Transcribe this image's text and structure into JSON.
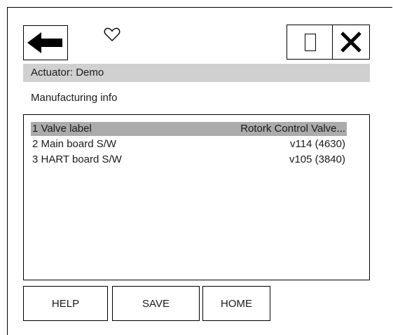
{
  "header": {
    "back_icon": "arrow-left-icon",
    "favorite_icon": "heart-outline-icon",
    "stop_icon": "square-icon",
    "close_icon": "close-x-icon",
    "title": "Actuator: Demo"
  },
  "page": {
    "subtitle": "Manufacturing info"
  },
  "list": {
    "items": [
      {
        "label": "1 Valve label",
        "value": "Rotork Control Valve...",
        "selected": true
      },
      {
        "label": "2 Main board S/W",
        "value": "v114 (4630)",
        "selected": false
      },
      {
        "label": "3 HART board S/W",
        "value": "v105 (3840)",
        "selected": false
      }
    ]
  },
  "footer": {
    "help_label": "HELP",
    "save_label": "SAVE",
    "home_label": "HOME"
  },
  "colors": {
    "title_bar_bg": "#d0d0d0",
    "selected_row_bg": "#ababab"
  }
}
